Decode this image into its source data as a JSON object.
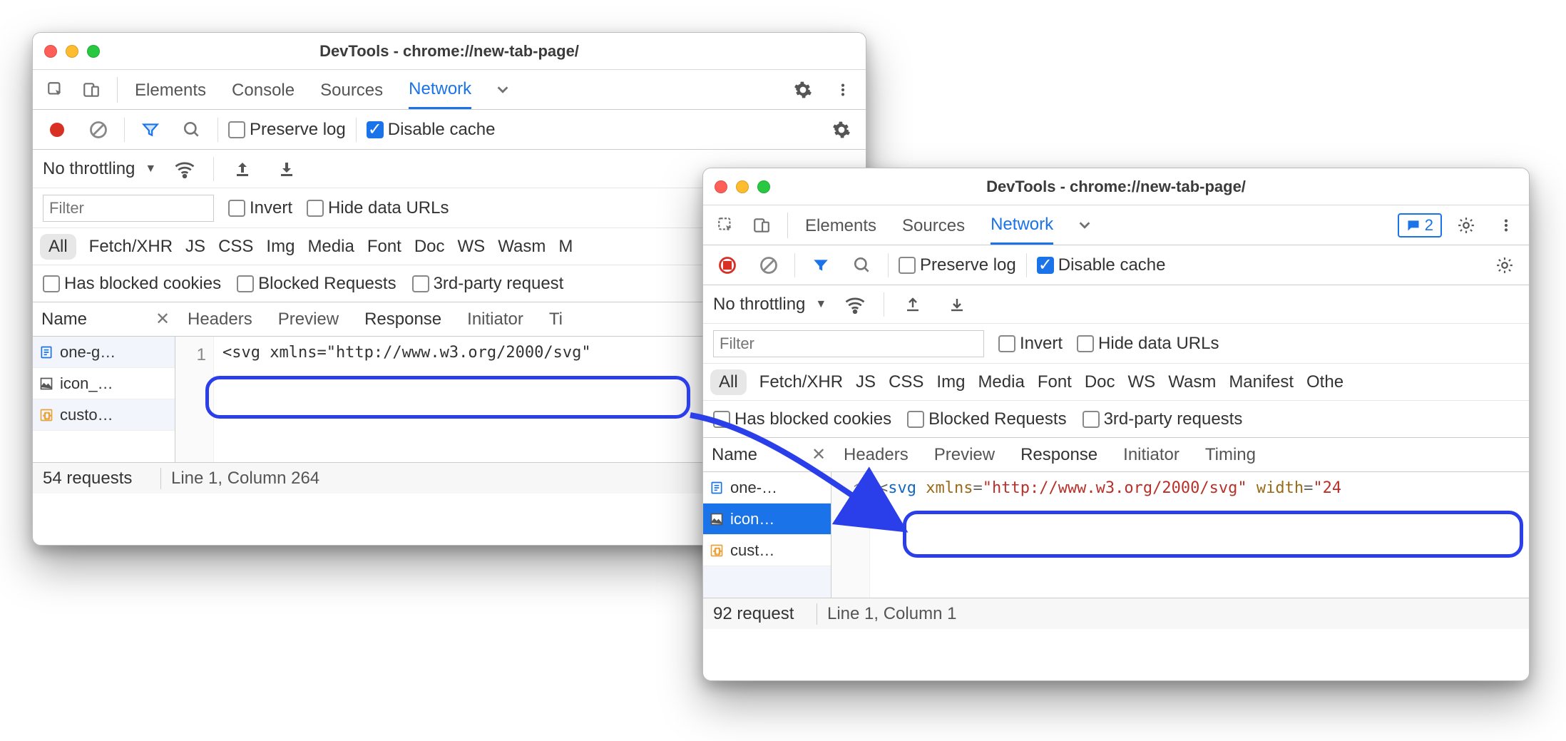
{
  "windowA": {
    "title": "DevTools - chrome://new-tab-page/",
    "tabs": [
      "Elements",
      "Console",
      "Sources",
      "Network"
    ],
    "active_tab": "Network",
    "toolbar": {
      "preserve_log": "Preserve log",
      "disable_cache": "Disable cache"
    },
    "throttling": {
      "label": "No throttling"
    },
    "filter": {
      "placeholder": "Filter",
      "invert": "Invert",
      "hide_data_urls": "Hide data URLs"
    },
    "types": [
      "All",
      "Fetch/XHR",
      "JS",
      "CSS",
      "Img",
      "Media",
      "Font",
      "Doc",
      "WS",
      "Wasm",
      "M"
    ],
    "blocked": {
      "cookies": "Has blocked cookies",
      "requests": "Blocked Requests",
      "third": "3rd-party request"
    },
    "columns": {
      "name": "Name",
      "headers": "Headers",
      "preview": "Preview",
      "response": "Response",
      "initiator": "Initiator",
      "timing": "Ti"
    },
    "files": [
      "one-g…",
      "icon_…",
      "custo…"
    ],
    "code": {
      "line": "1",
      "text_plain": "<svg xmlns=\"http://www.w3.org/2000/svg\""
    },
    "status": {
      "requests": "54 requests",
      "pos": "Line 1, Column 264"
    }
  },
  "windowB": {
    "title": "DevTools - chrome://new-tab-page/",
    "tabs": [
      "Elements",
      "Sources",
      "Network"
    ],
    "active_tab": "Network",
    "badge": "2",
    "toolbar": {
      "preserve_log": "Preserve log",
      "disable_cache": "Disable cache"
    },
    "throttling": {
      "label": "No throttling"
    },
    "filter": {
      "placeholder": "Filter",
      "invert": "Invert",
      "hide_data_urls": "Hide data URLs"
    },
    "types": [
      "All",
      "Fetch/XHR",
      "JS",
      "CSS",
      "Img",
      "Media",
      "Font",
      "Doc",
      "WS",
      "Wasm",
      "Manifest",
      "Othe"
    ],
    "blocked": {
      "cookies": "Has blocked cookies",
      "requests": "Blocked Requests",
      "third": "3rd-party requests"
    },
    "columns": {
      "name": "Name",
      "headers": "Headers",
      "preview": "Preview",
      "response": "Response",
      "initiator": "Initiator",
      "timing": "Timing"
    },
    "files": [
      "one-…",
      "icon…",
      "cust…"
    ],
    "code": {
      "line": "1",
      "tag_open": "<",
      "tag": "svg",
      "attr1": "xmlns",
      "eq": "=",
      "val1": "\"http://www.w3.org/2000/svg\"",
      "attr2": "width",
      "val2": "\"24"
    },
    "status": {
      "requests": "92 request",
      "pos": "Line 1, Column 1"
    }
  }
}
